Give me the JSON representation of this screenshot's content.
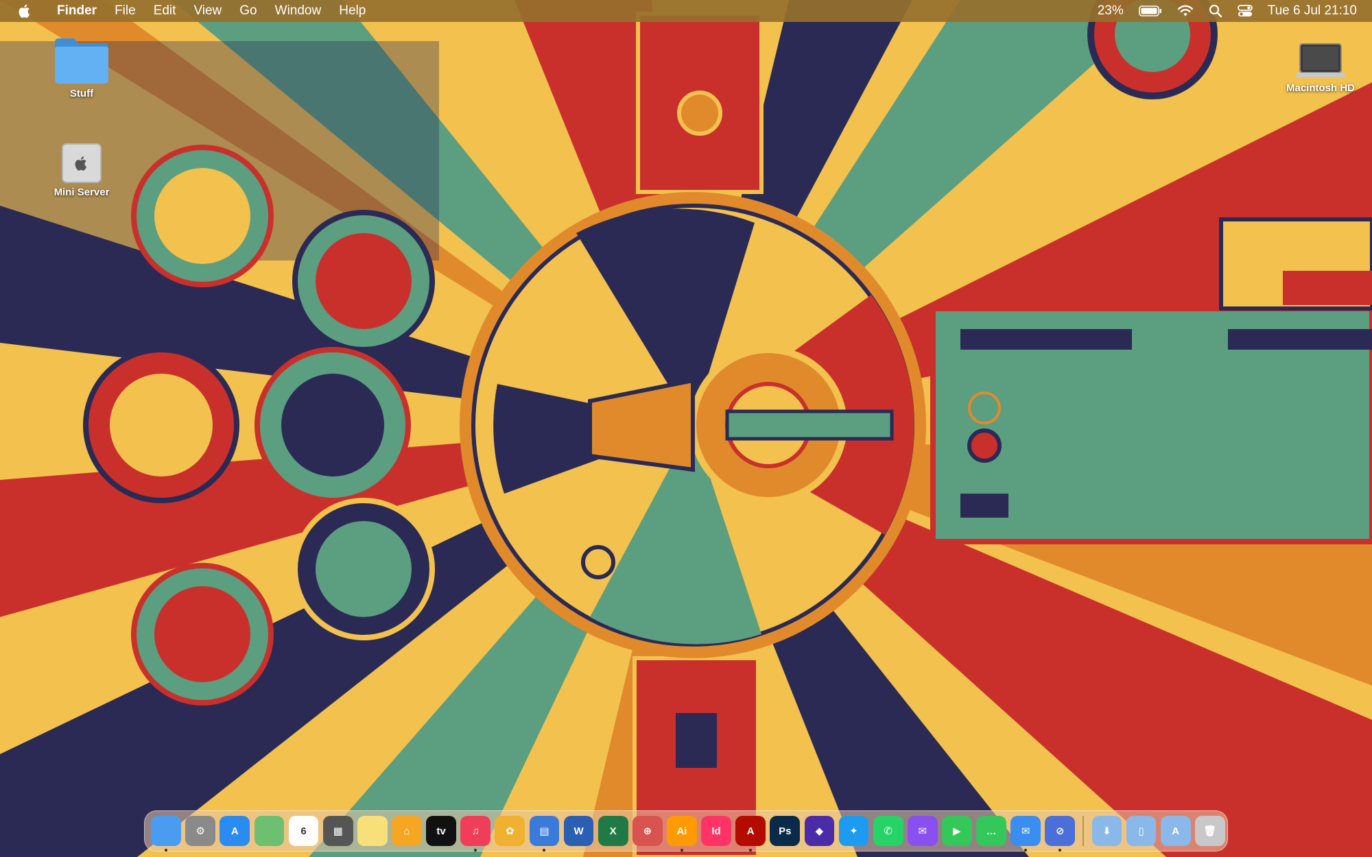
{
  "menubar": {
    "app_name": "Finder",
    "menus": [
      "File",
      "Edit",
      "View",
      "Go",
      "Window",
      "Help"
    ],
    "battery_percent": "23%",
    "datetime": "Tue 6 Jul  21:10",
    "icons": [
      "apple-logo-icon",
      "battery-icon",
      "wifi-icon",
      "spotlight-search-icon",
      "control-center-icon"
    ]
  },
  "desktop": {
    "icons": [
      {
        "label": "Stuff",
        "icon": "folder-icon"
      },
      {
        "label": "Mini Server",
        "icon": "server-drive-icon"
      },
      {
        "label": "Macintosh HD",
        "icon": "laptop-drive-icon"
      }
    ]
  },
  "dock": {
    "apps": [
      {
        "name": "finder",
        "glyph": "",
        "color": "#4a9cf0",
        "running": true
      },
      {
        "name": "system-preferences",
        "glyph": "⚙",
        "color": "#8a8a8a",
        "running": false
      },
      {
        "name": "app-store",
        "glyph": "A",
        "color": "#2a8cf0",
        "running": false
      },
      {
        "name": "maps",
        "glyph": "",
        "color": "#6cc070",
        "running": false
      },
      {
        "name": "calendar",
        "glyph": "6",
        "color": "#ffffff",
        "text_color": "#333333",
        "running": false
      },
      {
        "name": "calculator",
        "glyph": "▦",
        "color": "#555555",
        "running": false
      },
      {
        "name": "notes",
        "glyph": "",
        "color": "#f7e07a",
        "running": false
      },
      {
        "name": "home",
        "glyph": "⌂",
        "color": "#f5a623",
        "running": false
      },
      {
        "name": "apple-tv",
        "glyph": "tv",
        "color": "#111111",
        "running": false
      },
      {
        "name": "music",
        "glyph": "♫",
        "color": "#f03e5a",
        "running": true
      },
      {
        "name": "photos",
        "glyph": "✿",
        "color": "#f0b030",
        "running": false
      },
      {
        "name": "keynote",
        "glyph": "▤",
        "color": "#3a7ad9",
        "running": true
      },
      {
        "name": "microsoft-word",
        "glyph": "W",
        "color": "#2b5fb4",
        "running": false
      },
      {
        "name": "microsoft-excel",
        "glyph": "X",
        "color": "#1f7a45",
        "running": false
      },
      {
        "name": "remote-desktop",
        "glyph": "⊕",
        "color": "#d9534f",
        "running": false
      },
      {
        "name": "adobe-illustrator",
        "glyph": "Ai",
        "color": "#ff9a00",
        "running": true
      },
      {
        "name": "adobe-indesign",
        "glyph": "Id",
        "color": "#ff3366",
        "running": false
      },
      {
        "name": "adobe-acrobat",
        "glyph": "A",
        "color": "#b30b00",
        "running": true
      },
      {
        "name": "adobe-photoshop",
        "glyph": "Ps",
        "color": "#0a2a4a",
        "running": false
      },
      {
        "name": "monitoring-app",
        "glyph": "◆",
        "color": "#4b2ca8",
        "running": false
      },
      {
        "name": "twitter",
        "glyph": "✦",
        "color": "#1d9bf0",
        "running": false
      },
      {
        "name": "whatsapp",
        "glyph": "✆",
        "color": "#25d366",
        "running": false
      },
      {
        "name": "messenger",
        "glyph": "✉",
        "color": "#8a4ff0",
        "running": false
      },
      {
        "name": "facetime",
        "glyph": "▶",
        "color": "#34c759",
        "running": false
      },
      {
        "name": "messages",
        "glyph": "…",
        "color": "#34c759",
        "running": false
      },
      {
        "name": "mail",
        "glyph": "✉",
        "color": "#3a8ef0",
        "running": true
      },
      {
        "name": "safari",
        "glyph": "⊘",
        "color": "#4b6fd8",
        "running": true
      }
    ],
    "stacks": [
      {
        "name": "downloads-stack",
        "glyph": "⬇",
        "color": "#8ab8e8"
      },
      {
        "name": "documents-stack",
        "glyph": "▯",
        "color": "#8ab8e8"
      },
      {
        "name": "applications-stack",
        "glyph": "A",
        "color": "#8ab8e8"
      },
      {
        "name": "trash",
        "glyph": "🗑",
        "color": "#c8c8c8"
      }
    ]
  }
}
